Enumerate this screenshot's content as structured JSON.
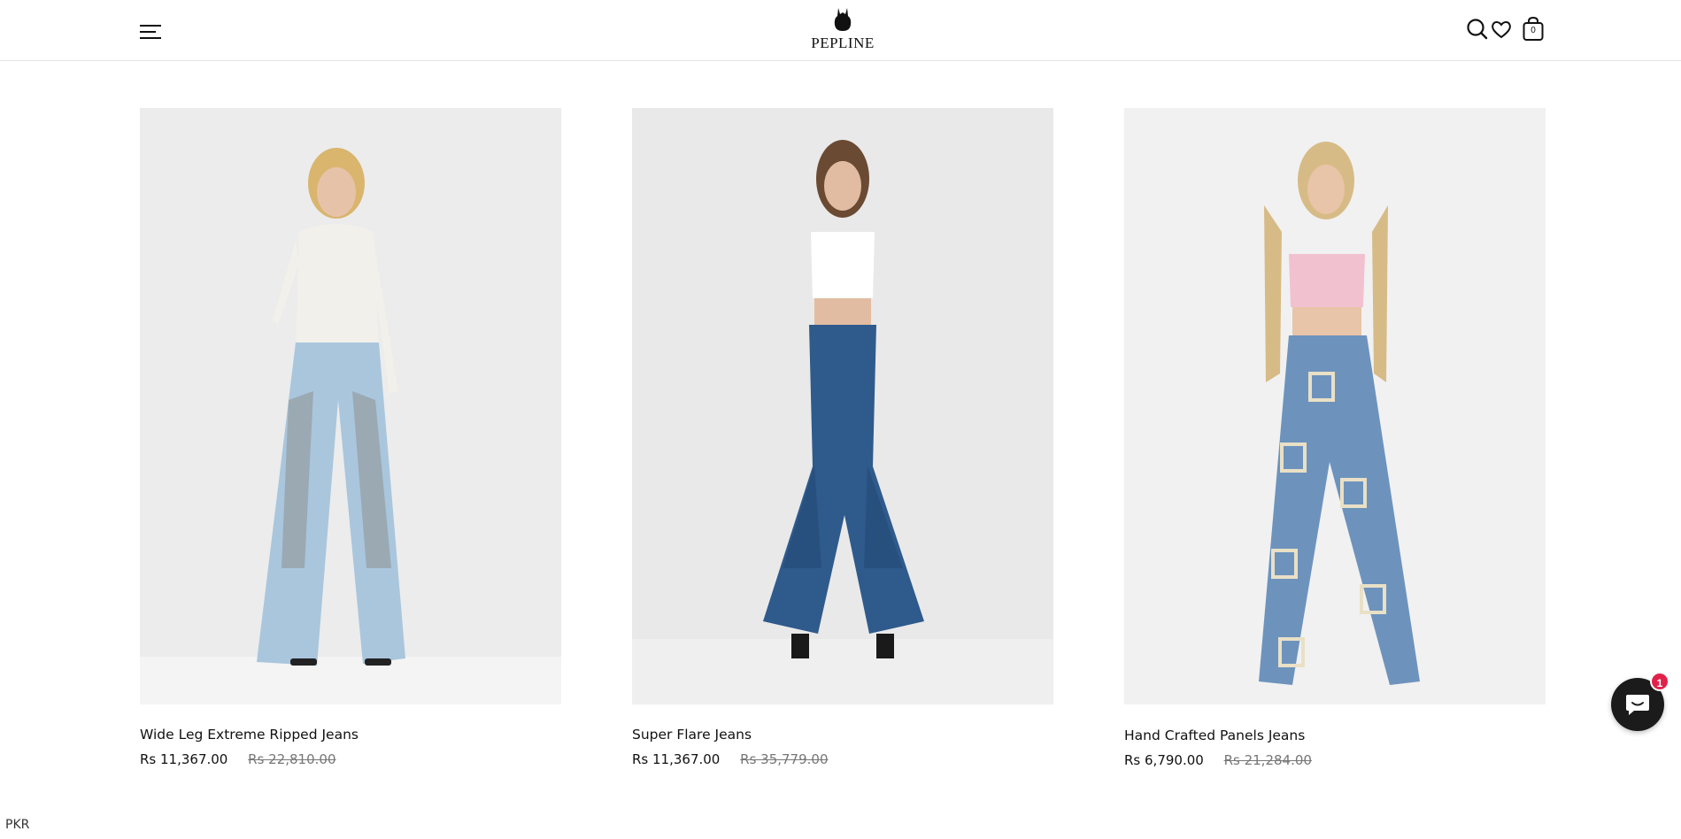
{
  "brand": {
    "name": "Pepline",
    "logo_text": "PEPLINE"
  },
  "header": {
    "menu_icon": "hamburger-menu-icon",
    "search_icon": "search-icon",
    "wishlist_icon": "heart-icon",
    "cart_icon": "shopping-bag-icon",
    "cart_count": "0"
  },
  "products": [
    {
      "title": "Wide Leg Extreme Ripped Jeans",
      "price": "Rs 11,367.00",
      "compare_price": "Rs 22,810.00",
      "top_color": "#f2f0ea",
      "denim_color": "#a9c6dd"
    },
    {
      "title": "Super Flare Jeans",
      "price": "Rs 11,367.00",
      "compare_price": "Rs 35,779.00",
      "top_color": "#ffffff",
      "denim_color": "#2f5a8c"
    },
    {
      "title": "Hand Crafted Panels Jeans",
      "price": "Rs 6,790.00",
      "compare_price": "Rs 21,284.00",
      "top_color": "#f2c1cf",
      "denim_color": "#6d93bd"
    }
  ],
  "footer": {
    "currency": "PKR"
  },
  "chat": {
    "icon": "chat-bubble-icon",
    "badge": "1",
    "accent": "#e0224a"
  }
}
